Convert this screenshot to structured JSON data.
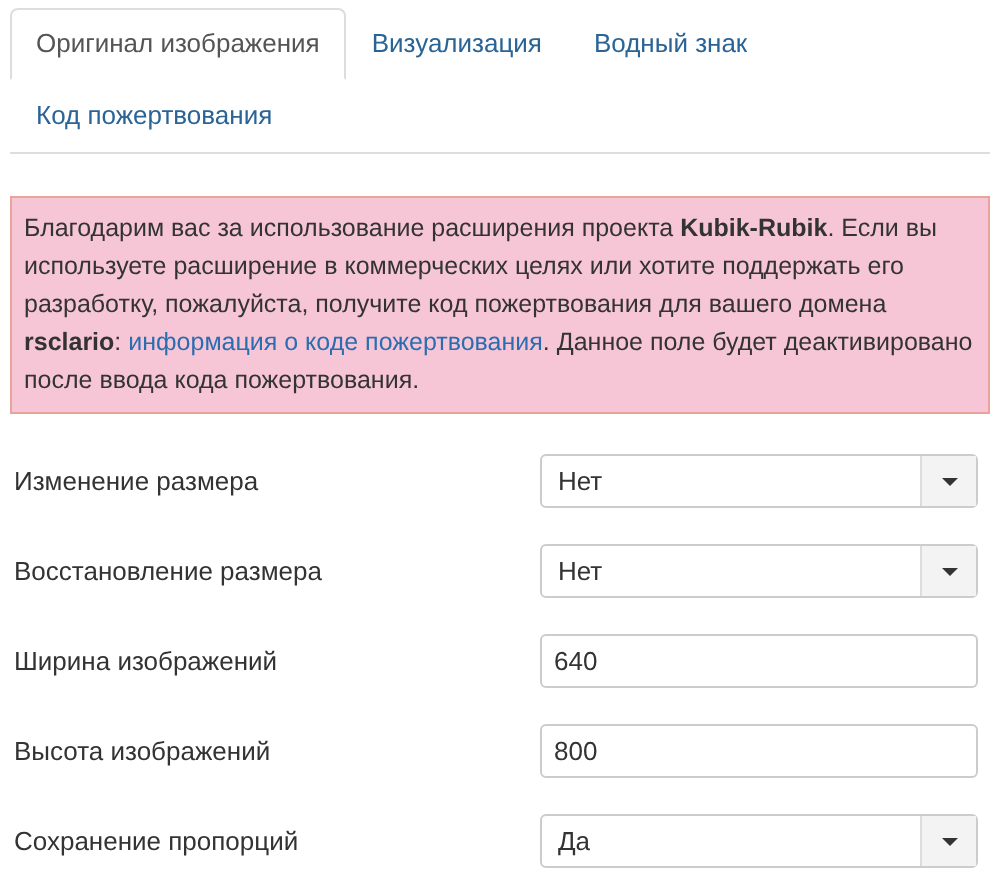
{
  "tabs": [
    {
      "label": "Оригинал изображения",
      "selected": true
    },
    {
      "label": "Визуализация",
      "selected": false
    },
    {
      "label": "Водный знак",
      "selected": false
    },
    {
      "label": "Код пожертвования",
      "selected": false
    }
  ],
  "alert": {
    "text_before": "Благодарим вас за использование расширения проекта **Kubik-Rubik**. Если вы используете расширение в коммерческих целях или хотите поддержать его разработку, пожалуйста, получите код пожертвования для вашего домена **rsclario**: ",
    "link": "информация о коде пожертвования",
    "text_after": ". Данное поле будет деактивировано после ввода кода пожертвования."
  },
  "fields": [
    {
      "label": "Изменение размера",
      "kind": "select",
      "value": "Нет"
    },
    {
      "label": "Восстановление размера",
      "kind": "select",
      "value": "Нет"
    },
    {
      "label": "Ширина изображений",
      "kind": "input",
      "value": "640"
    },
    {
      "label": "Высота изображений",
      "kind": "input",
      "value": "800"
    },
    {
      "label": "Сохранение пропорций",
      "kind": "select",
      "value": "Да"
    }
  ]
}
